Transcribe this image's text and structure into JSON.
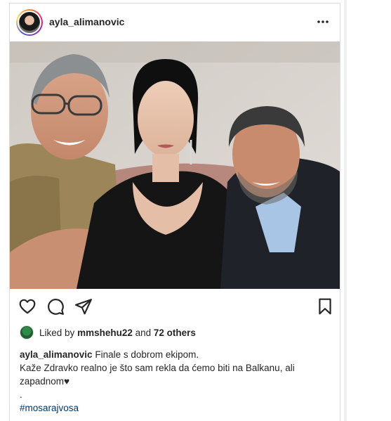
{
  "post": {
    "username": "ayla_alimanovic",
    "likes": {
      "prefix": "Liked by",
      "first_liker": "mmshehu22",
      "conjunction": "and",
      "others": "72 others"
    },
    "caption": {
      "author": "ayla_alimanovic",
      "line1": "Finale s dobrom ekipom.",
      "line2": "Kaže Zdravko realno je što sam rekla da ćemo biti na Balkanu, ali",
      "line3": "zapadnom♥",
      "line4": ".",
      "hashtag": "#mosarajvosa"
    }
  },
  "icons": [
    "more-options-icon",
    "heart-icon",
    "comment-icon",
    "share-icon",
    "bookmark-icon"
  ],
  "colors": {
    "link": "#00376b",
    "text": "#262626",
    "border": "#dbdbdb"
  }
}
